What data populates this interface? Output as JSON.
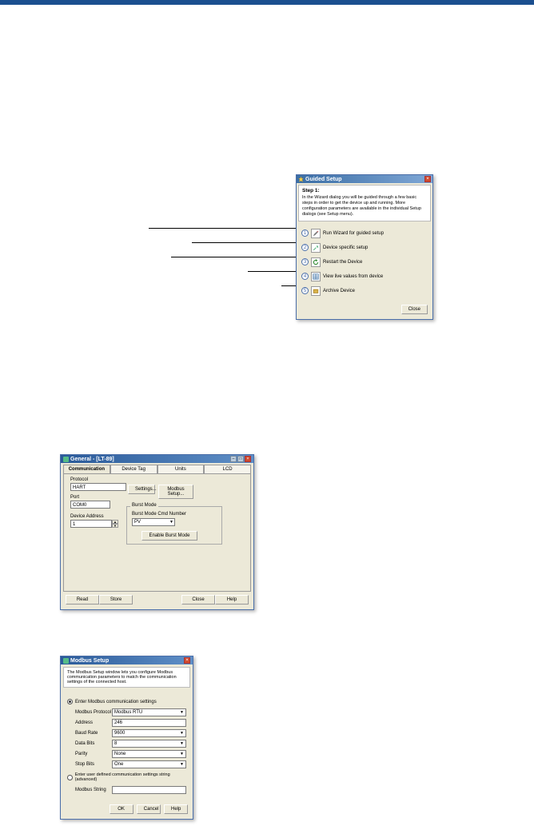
{
  "guided": {
    "title": "Guided Setup",
    "step_title": "Step 1:",
    "step_text": "In the Wizard dialog you will be guided through a few basic steps in order to get the device up and running. More configuration parameters are available in the individual Setup dialogs (see Setup menu).",
    "options": [
      {
        "num": "1",
        "label": "Run Wizard for guided setup"
      },
      {
        "num": "2",
        "label": "Device specific setup"
      },
      {
        "num": "3",
        "label": "Restart the Device"
      },
      {
        "num": "4",
        "label": "View live values from device"
      },
      {
        "num": "5",
        "label": "Archive Device"
      }
    ],
    "close": "Close"
  },
  "general": {
    "title": "General - [LT-89]",
    "tabs": [
      "Communication",
      "Device Tag",
      "Units",
      "LCD"
    ],
    "protocol_label": "Protocol",
    "protocol_value": "HART",
    "port_label": "Port",
    "port_value": "COM0",
    "settings_btn": "Settings...",
    "modbus_setup_btn": "Modbus Setup...",
    "device_addr_label": "Device Address",
    "device_addr_value": "1",
    "burst_group": "Burst Mode",
    "burst_cmd_label": "Burst Mode Cmd Number",
    "burst_cmd_value": "PV",
    "enable_burst_btn": "Enable Burst Mode",
    "footer": {
      "read": "Read",
      "store": "Store",
      "close": "Close",
      "help": "Help"
    }
  },
  "modbus": {
    "title": "Modbus Setup",
    "desc": "The Modbus Setup window lets you configure Modbus communication parameters to match the communication settings of the connected host.",
    "radio_enter": "Enter Modbus communication settings",
    "fields": {
      "protocol": {
        "label": "Modbus Protocol",
        "value": "Modbus RTU"
      },
      "address": {
        "label": "Address",
        "value": "246"
      },
      "baud": {
        "label": "Baud Rate",
        "value": "9600"
      },
      "databits": {
        "label": "Data Bits",
        "value": "8"
      },
      "parity": {
        "label": "Parity",
        "value": "None"
      },
      "stopbits": {
        "label": "Stop Bits",
        "value": "One"
      }
    },
    "radio_user": "Enter user defined communication settings string (advanced)",
    "string_label": "Modbus String",
    "string_value": "",
    "footer": {
      "ok": "OK",
      "cancel": "Cancel",
      "help": "Help"
    }
  }
}
